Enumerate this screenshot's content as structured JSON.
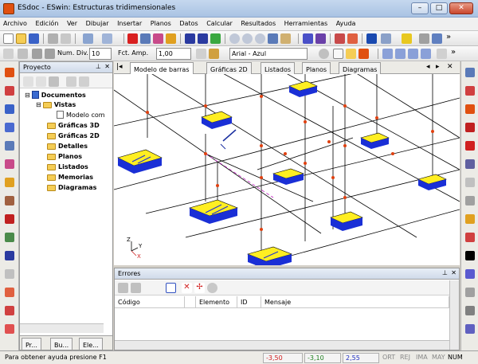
{
  "window": {
    "title": "ESdoc - ESwin: Estructuras tridimensionales"
  },
  "menu": [
    "Archivo",
    "Edición",
    "Ver",
    "Dibujar",
    "Insertar",
    "Planos",
    "Datos",
    "Calcular",
    "Resultados",
    "Herramientas",
    "Ayuda"
  ],
  "toolbar2": {
    "num_div_label": "Num. Div.",
    "num_div_value": "10",
    "fct_amp_label": "Fct. Amp.",
    "fct_amp_value": "1,00",
    "font_value": "Arial - Azul"
  },
  "project": {
    "title": "Proyecto",
    "root": "Documentos",
    "vistas": "Vistas",
    "modelo": "Modelo com",
    "items": [
      "Gráficas 3D",
      "Gráficas 2D",
      "Detalles",
      "Planos",
      "Listados",
      "Memorias",
      "Diagramas"
    ],
    "bottom_tabs": [
      "Pr...",
      "Bu...",
      "Ele..."
    ]
  },
  "tabs": [
    "Modelo de barras",
    "Gráficas 2D",
    "Listados",
    "Planos",
    "Diagramas"
  ],
  "axes": {
    "z": "Z",
    "y": "Y",
    "x": "X"
  },
  "errors": {
    "title": "Errores",
    "columns": [
      "Código",
      "Elemento",
      "ID",
      "Mensaje"
    ]
  },
  "status": {
    "help": "Para obtener ayuda presione F1",
    "x": "-3,50",
    "y": "-3,10",
    "z": "2,55",
    "indicators": [
      "ORT",
      "REJ",
      "IMA",
      "MAY",
      "NUM"
    ]
  },
  "colors": {
    "accent": "#e05010",
    "support_top": "#ffee22",
    "support_side": "#1a2fd6"
  }
}
